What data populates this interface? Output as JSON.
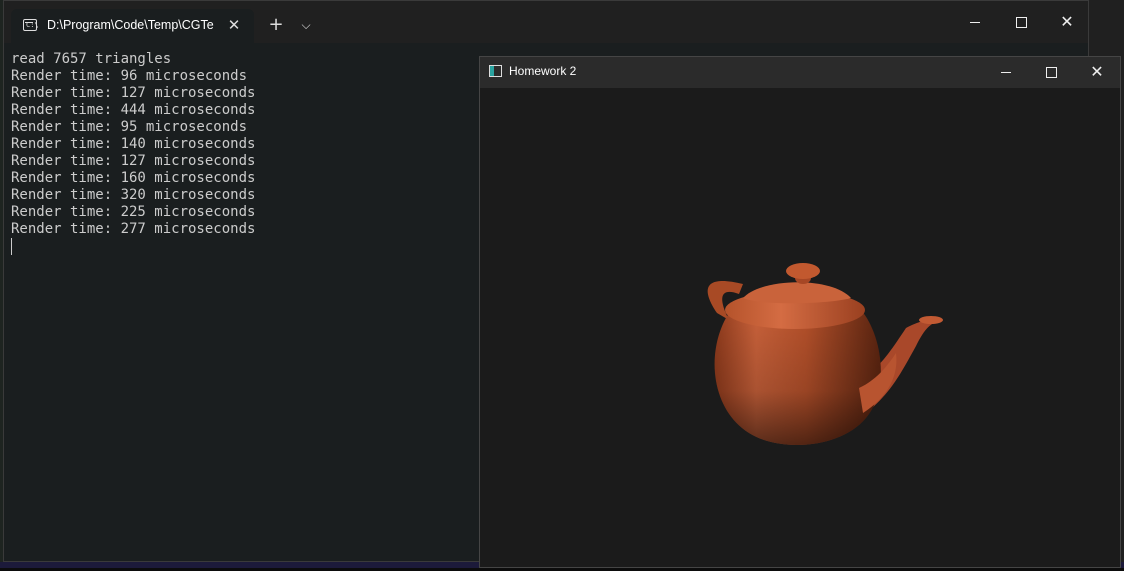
{
  "terminal": {
    "tab_title": "D:\\Program\\Code\\Temp\\CGTe",
    "tab_close_icon": "close-icon",
    "new_tab_icon": "plus-icon",
    "dropdown_icon": "chevron-down-icon",
    "output_lines": [
      "read 7657 triangles",
      "Render time: 96 microseconds",
      "Render time: 127 microseconds",
      "Render time: 444 microseconds",
      "Render time: 95 microseconds",
      "Render time: 140 microseconds",
      "Render time: 127 microseconds",
      "Render time: 160 microseconds",
      "Render time: 320 microseconds",
      "Render time: 225 microseconds",
      "Render time: 277 microseconds"
    ]
  },
  "gl_window": {
    "title": "Homework 2",
    "scene": "teapot",
    "teapot_color": "#c0562f",
    "background_color": "#1b1b1b"
  },
  "colors": {
    "terminal_bg": "#1a1e1f",
    "terminal_text": "#cccccc",
    "titlebar": "#202020"
  }
}
